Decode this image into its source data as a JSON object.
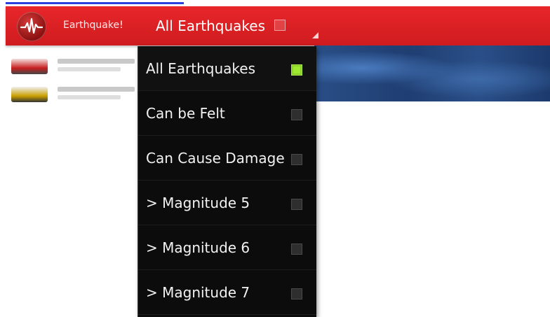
{
  "appbar": {
    "app_title": "Earthquake!",
    "spinner_label": "All Earthquakes",
    "color": "#e8262a"
  },
  "filter_menu": {
    "items": [
      {
        "label": "All Earthquakes",
        "checked": true
      },
      {
        "label": "Can be Felt",
        "checked": false
      },
      {
        "label": "Can Cause Damage",
        "checked": false
      },
      {
        "label": "> Magnitude 5",
        "checked": false
      },
      {
        "label": "> Magnitude 6",
        "checked": false
      },
      {
        "label": "> Magnitude 7",
        "checked": false
      }
    ]
  },
  "icons": {
    "app_logo": "seismograph-icon",
    "spinner_arrow": "dropdown-corner-icon"
  },
  "colors": {
    "accent_red": "#e8262a",
    "menu_bg": "#0c0c0c",
    "check_on": "#9ee832"
  }
}
